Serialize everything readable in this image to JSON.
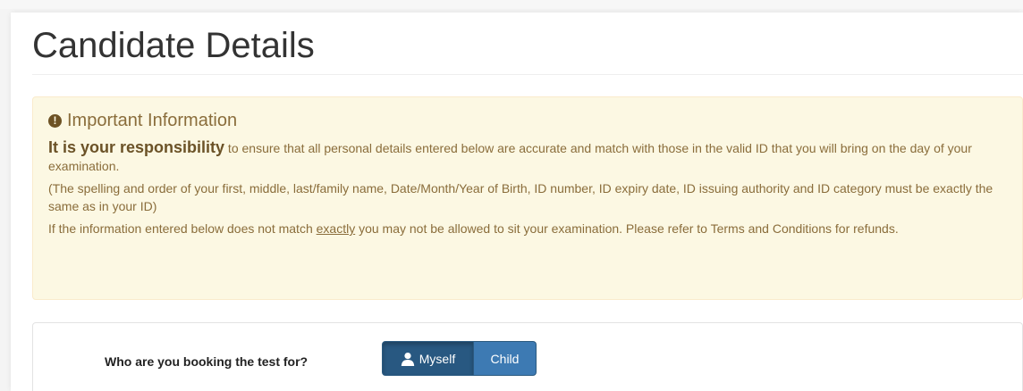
{
  "page": {
    "title": "Candidate Details"
  },
  "alert": {
    "icon": "exclamation-circle-icon",
    "heading": "Important Information",
    "paragraph1_strong": "It is your responsibility",
    "paragraph1_rest": " to ensure that all personal details entered below are accurate and match with those in the valid ID that you will bring on the day of your examination.",
    "paragraph2": "(The spelling and order of your first, middle, last/family name, Date/Month/Year of Birth, ID number, ID expiry date, ID issuing authority and ID category must be exactly the same as in your ID)",
    "paragraph3_before": "If the information entered below does not match ",
    "paragraph3_emphasis": "exactly",
    "paragraph3_after": " you may not be allowed to sit your examination. Please refer to Terms and Conditions for refunds.",
    "colors": {
      "background": "#fcf8e3",
      "border": "#faebcc",
      "text": "#8a6d3b"
    }
  },
  "booking": {
    "question": "Who are you booking the test for?",
    "options": [
      {
        "label": "Myself",
        "icon": "user-icon",
        "selected": true
      },
      {
        "label": "Child",
        "selected": false
      }
    ],
    "colors": {
      "selected": "#285881",
      "unselected": "#3d7ab3"
    }
  }
}
